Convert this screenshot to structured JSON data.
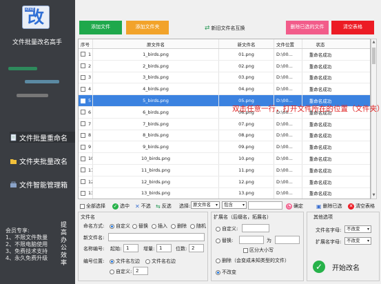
{
  "app": {
    "logo_tag": "KEKE",
    "logo_char": "改",
    "title": "文件批量改名高手"
  },
  "nav": [
    "文件批量重命名",
    "文件夹批量改名",
    "文件智能管理箱"
  ],
  "sidebar_footer": {
    "heading": "会员专享:",
    "lines": [
      "1、不限文件数量",
      "2、不限电脑使用",
      "3、免费技术支持",
      "4、永久免费升级"
    ],
    "vertical": "提高办公效率"
  },
  "toolbar": {
    "add_file": "添加文件",
    "add_folder": "添加文件夹",
    "swap": "新旧文件名互换",
    "delete_selected": "删除已选的文件",
    "clear": "清空表格"
  },
  "table": {
    "headers": [
      "序号",
      "原文件名",
      "新文件名",
      "文件位置",
      "状态"
    ],
    "rows": [
      [
        "1",
        "1_birds.png",
        "01.png",
        "D:\\00...",
        "重命名成功"
      ],
      [
        "2",
        "2_birds.png",
        "02.png",
        "D:\\00...",
        "重命名成功"
      ],
      [
        "3",
        "3_birds.png",
        "03.png",
        "D:\\00...",
        "重命名成功"
      ],
      [
        "4",
        "4_birds.png",
        "04.png",
        "D:\\00...",
        "重命名成功"
      ],
      [
        "5",
        "5_birds.png",
        "05.png",
        "D:\\00...",
        "重命名成功"
      ],
      [
        "6",
        "6_birds.png",
        "06.png",
        "D:\\00...",
        "重命名成功"
      ],
      [
        "7",
        "7_birds.png",
        "07.png",
        "D:\\00...",
        "重命名成功"
      ],
      [
        "8",
        "8_birds.png",
        "08.png",
        "D:\\00...",
        "重命名成功"
      ],
      [
        "9",
        "9_birds.png",
        "09.png",
        "D:\\00...",
        "重命名成功"
      ],
      [
        "10",
        "10_birds.png",
        "10.png",
        "D:\\00...",
        "重命名成功"
      ],
      [
        "11",
        "11_birds.png",
        "11.png",
        "D:\\00...",
        "重命名成功"
      ],
      [
        "12",
        "12_birds.png",
        "12.png",
        "D:\\00...",
        "重命名成功"
      ],
      [
        "13",
        "13_birds.png",
        "13.png",
        "D:\\00...",
        "重命名成功"
      ]
    ],
    "selected_row": 4,
    "overlay": "双击任意一行，打开文件所在的位置（文件夹）"
  },
  "selection_bar": {
    "select_all": "全部选择",
    "select": "选中",
    "unselect": "不选",
    "invert": "反选",
    "choose": "选择:",
    "field_value": "原文件名",
    "op_value": "包含",
    "confirm": "确定",
    "delete_selected": "删除已选",
    "clear_table": "清空表格"
  },
  "filename": {
    "section": "文件名",
    "method_label": "命名方式:",
    "methods": [
      "自定义",
      "替换",
      "插入",
      "删除",
      "随机"
    ],
    "new_name_label": "新文件名:",
    "new_name_value": "",
    "numbering_label": "名称编号:",
    "start_label": "起始:",
    "start_value": "1",
    "step_label": "增量:",
    "step_value": "1",
    "digits_label": "位数:",
    "digits_value": "2",
    "position_label": "编号位置:",
    "pos_left": "文件名左边",
    "pos_right": "文件名右边",
    "pos_custom": "自定义:",
    "pos_custom_value": "2"
  },
  "extension": {
    "section": "扩展名（后缀名，拓展名）",
    "custom": "自定义:",
    "custom_value": "",
    "replace": "替换:",
    "replace_to": "为",
    "case": "区分大小写",
    "delete": "删除（会变成未知类型的文件）",
    "unchanged": "不改变"
  },
  "other": {
    "section": "其他选项",
    "name_case_label": "文件名字母:",
    "name_case_value": "不改变",
    "ext_case_label": "扩展名字母:",
    "ext_case_value": "不改变"
  },
  "start_button": "开始改名",
  "colors": {
    "sidebar": "#3a3d42",
    "add_file": "#1fa84b",
    "add_folder": "#f2a32a",
    "delete_selected": "#f25c8a",
    "clear": "#ec1b24",
    "selected_row": "#3b82e0",
    "overlay_text": "#e02222"
  }
}
